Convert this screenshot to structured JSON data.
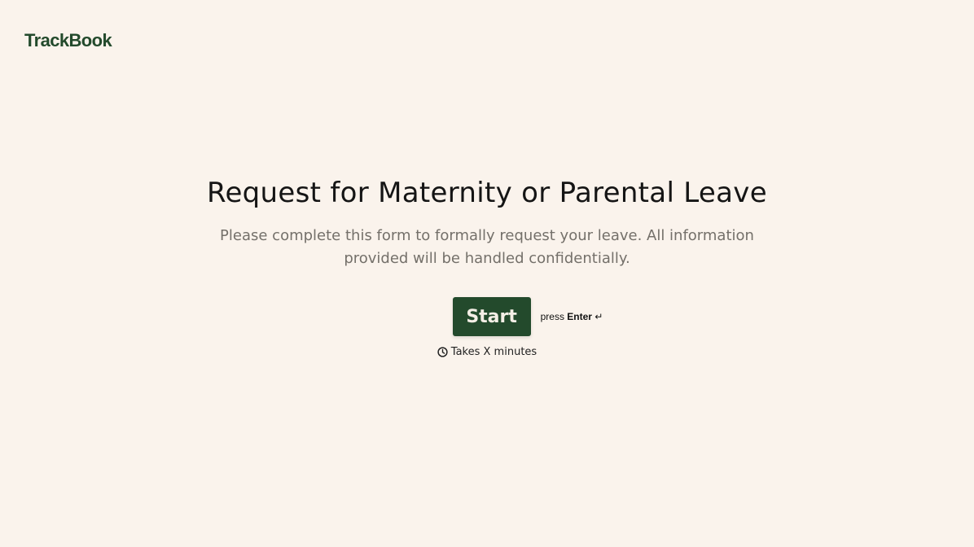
{
  "brand": {
    "name": "TrackBook",
    "color": "#234a2c"
  },
  "welcome": {
    "title": "Request for Maternity or Parental Leave",
    "subtitle": "Please complete this form to formally request your leave. All information provided will be handled confidentially.",
    "start_label": "Start",
    "hint_prefix": "press",
    "hint_key": "Enter",
    "hint_icon": "↵",
    "duration_icon": "clock-icon",
    "duration_text": "Takes X minutes"
  },
  "colors": {
    "background": "#faf3ec",
    "button": "#234a2c",
    "subtitle": "#74706a"
  }
}
